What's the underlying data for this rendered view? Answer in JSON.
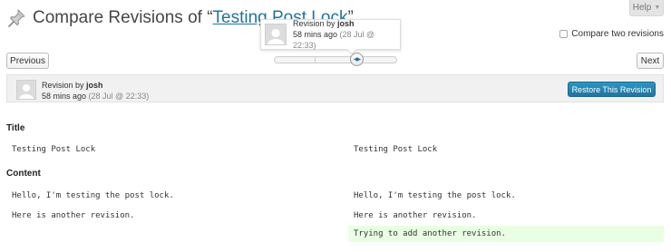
{
  "help": {
    "label": "Help"
  },
  "header": {
    "title_prefix": "Compare Revisions of “",
    "title_link": "Testing Post Lock",
    "title_suffix": "”"
  },
  "compare": {
    "label": "Compare two revisions",
    "checked": false
  },
  "tooltip": {
    "prefix": "Revision by ",
    "author": "josh",
    "time": "58 mins ago",
    "date": "(28 Jul @ 22:33)"
  },
  "nav": {
    "previous": "Previous",
    "next": "Next"
  },
  "revision": {
    "prefix": "Revision by ",
    "author": "josh",
    "time": "58 mins ago",
    "date": "(28 Jul @ 22:33)",
    "restore_label": "Restore This Revision"
  },
  "diff": {
    "title_heading": "Title",
    "title_left": "Testing Post Lock",
    "title_right": "Testing Post Lock",
    "content_heading": "Content",
    "content_left": [
      "Hello, I'm testing the post lock.",
      "Here is another revision."
    ],
    "content_right": [
      "Hello, I'm testing the post lock.",
      "Here is another revision."
    ],
    "content_added": "Trying to add another revision."
  },
  "colors": {
    "link": "#21759b",
    "primary_button": "#21759b",
    "added_line_bg": "#e9ffe3"
  },
  "icons": {
    "title_icon": "pushpin-icon",
    "slider_handle": "arrows-icon",
    "avatar": "avatar-placeholder-icon"
  }
}
